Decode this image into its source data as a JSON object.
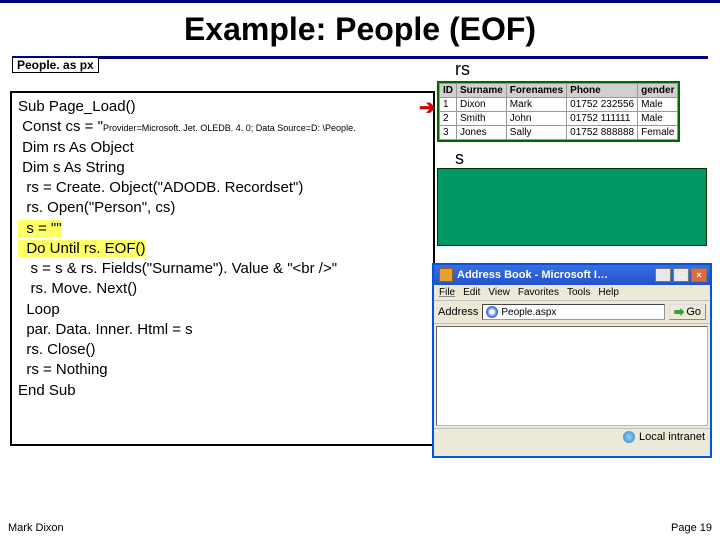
{
  "title": "Example: People (EOF)",
  "code_label": "People. as\npx",
  "code": {
    "l1": "Sub Page_Load()",
    "l2a": " Const cs = \"",
    "l2b": "Provider=Microsoft. Jet. OLEDB. 4. 0; Data Source=D: \\People.",
    "l3": " Dim rs As Object",
    "l4": " Dim s As String",
    "l5": "  rs = Create. Object(\"ADODB. Recordset\")",
    "l6": "  rs. Open(\"Person\", cs)",
    "l7": "  s = \"\"",
    "l8": "  Do Until rs. EOF()",
    "l9": "   s = s & rs. Fields(\"Surname\"). Value & \"<br />\"",
    "l10": "   rs. Move. Next()",
    "l11": "  Loop",
    "l12": "  par. Data. Inner. Html = s",
    "l13": "  rs. Close()",
    "l14": "  rs = Nothing",
    "l15": "End Sub"
  },
  "rs_label": "rs",
  "s_label": "s",
  "table": {
    "headers": [
      "ID",
      "Surname",
      "Forenames",
      "Phone",
      "gender"
    ],
    "rows": [
      [
        "1",
        "Dixon",
        "Mark",
        "01752 232556",
        "Male"
      ],
      [
        "2",
        "Smith",
        "John",
        "01752 111111",
        "Male"
      ],
      [
        "3",
        "Jones",
        "Sally",
        "01752 888888",
        "Female"
      ]
    ]
  },
  "browser": {
    "title": "Address Book - Microsoft I…",
    "menu": [
      "File",
      "Edit",
      "View",
      "Favorites",
      "Tools",
      "Help"
    ],
    "addr_label": "Address",
    "addr_value": "People.aspx",
    "go_label": "Go",
    "status": "Local intranet"
  },
  "footer": {
    "left": "Mark Dixon",
    "right": "Page 19"
  }
}
